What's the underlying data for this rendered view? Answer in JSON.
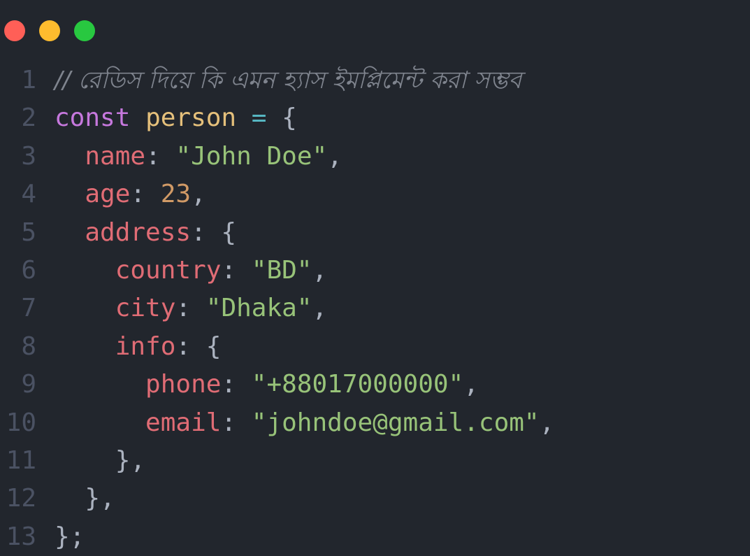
{
  "window": {
    "buttons": [
      {
        "name": "close",
        "color": "#ff5f57"
      },
      {
        "name": "minimize",
        "color": "#febc2e"
      },
      {
        "name": "maximize",
        "color": "#28c840"
      }
    ]
  },
  "colors": {
    "background": "#22262d",
    "line_number": "#4b5263",
    "comment": "#7f848e",
    "keyword": "#c678dd",
    "variable": "#e5c07b",
    "operator": "#56b6c2",
    "punctuation": "#abb2bf",
    "property": "#e06c75",
    "string": "#98c379",
    "number": "#d19a66"
  },
  "code": {
    "line_numbers": [
      "1",
      "2",
      "3",
      "4",
      "5",
      "6",
      "7",
      "8",
      "9",
      "10",
      "11",
      "12",
      "13"
    ],
    "lines": [
      [
        {
          "t": "// রেডিস দিয়ে কি এমন হ্যাস ইমপ্লিমেন্ট করা সম্ভব",
          "c": "comment"
        }
      ],
      [
        {
          "t": "const",
          "c": "keyword"
        },
        {
          "t": " ",
          "c": "punctuation"
        },
        {
          "t": "person",
          "c": "variable"
        },
        {
          "t": " ",
          "c": "punctuation"
        },
        {
          "t": "=",
          "c": "operator"
        },
        {
          "t": " {",
          "c": "punctuation"
        }
      ],
      [
        {
          "t": "  ",
          "c": "punctuation"
        },
        {
          "t": "name",
          "c": "property"
        },
        {
          "t": ": ",
          "c": "punctuation"
        },
        {
          "t": "\"John Doe\"",
          "c": "string"
        },
        {
          "t": ",",
          "c": "punctuation"
        }
      ],
      [
        {
          "t": "  ",
          "c": "punctuation"
        },
        {
          "t": "age",
          "c": "property"
        },
        {
          "t": ": ",
          "c": "punctuation"
        },
        {
          "t": "23",
          "c": "number"
        },
        {
          "t": ",",
          "c": "punctuation"
        }
      ],
      [
        {
          "t": "  ",
          "c": "punctuation"
        },
        {
          "t": "address",
          "c": "property"
        },
        {
          "t": ": {",
          "c": "punctuation"
        }
      ],
      [
        {
          "t": "    ",
          "c": "punctuation"
        },
        {
          "t": "country",
          "c": "property"
        },
        {
          "t": ": ",
          "c": "punctuation"
        },
        {
          "t": "\"BD\"",
          "c": "string"
        },
        {
          "t": ",",
          "c": "punctuation"
        }
      ],
      [
        {
          "t": "    ",
          "c": "punctuation"
        },
        {
          "t": "city",
          "c": "property"
        },
        {
          "t": ": ",
          "c": "punctuation"
        },
        {
          "t": "\"Dhaka\"",
          "c": "string"
        },
        {
          "t": ",",
          "c": "punctuation"
        }
      ],
      [
        {
          "t": "    ",
          "c": "punctuation"
        },
        {
          "t": "info",
          "c": "property"
        },
        {
          "t": ": {",
          "c": "punctuation"
        }
      ],
      [
        {
          "t": "      ",
          "c": "punctuation"
        },
        {
          "t": "phone",
          "c": "property"
        },
        {
          "t": ": ",
          "c": "punctuation"
        },
        {
          "t": "\"+88017000000\"",
          "c": "string"
        },
        {
          "t": ",",
          "c": "punctuation"
        }
      ],
      [
        {
          "t": "      ",
          "c": "punctuation"
        },
        {
          "t": "email",
          "c": "property"
        },
        {
          "t": ": ",
          "c": "punctuation"
        },
        {
          "t": "\"johndoe@gmail.com\"",
          "c": "string"
        },
        {
          "t": ",",
          "c": "punctuation"
        }
      ],
      [
        {
          "t": "    },",
          "c": "punctuation"
        }
      ],
      [
        {
          "t": "  },",
          "c": "punctuation"
        }
      ],
      [
        {
          "t": "};",
          "c": "punctuation"
        }
      ]
    ]
  }
}
